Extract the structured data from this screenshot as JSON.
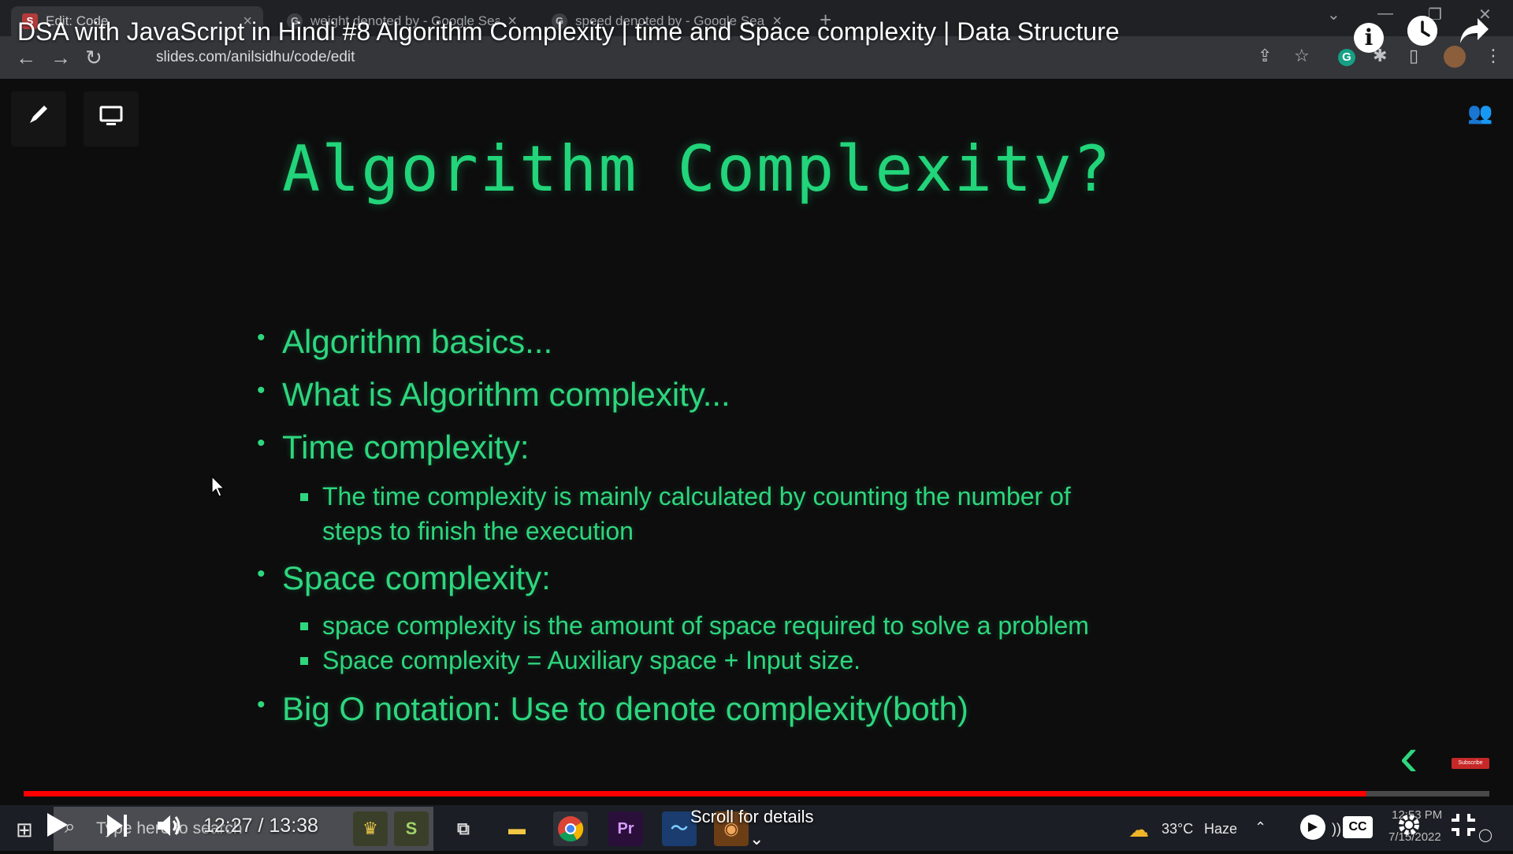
{
  "browser": {
    "tabs": [
      {
        "label": "Edit: Code",
        "favicon": "S"
      },
      {
        "label": "weight denoted by - Google Sear",
        "favicon": "G"
      },
      {
        "label": "speed denoted by - Google Sear",
        "favicon": "G"
      }
    ],
    "url": "slides.com/anilsidhu/code/edit"
  },
  "video": {
    "title": "DSA with JavaScript in Hindi #8 Algorithm Complexity | time and Space complexity | Data Structure",
    "current_time": "12:27",
    "duration": "13:38",
    "time_display": "12:27 / 13:38",
    "progress_fraction": 0.916,
    "scroll_hint": "Scroll for details"
  },
  "slide": {
    "title": "Algorithm Complexity?",
    "bullets": [
      {
        "level": 1,
        "text": "Algorithm basics..."
      },
      {
        "level": 1,
        "text": "What is Algorithm complexity..."
      },
      {
        "level": 1,
        "text": "Time complexity:"
      },
      {
        "level": 2,
        "text": "The time complexity is mainly calculated by counting the number of"
      },
      {
        "level": 2,
        "cont": true,
        "text": "steps to finish the execution"
      },
      {
        "level": 1,
        "text": "Space complexity:"
      },
      {
        "level": 2,
        "text": "space complexity is the amount of space required to solve a problem"
      },
      {
        "level": 2,
        "text": "Space complexity = Auxiliary space + Input size."
      },
      {
        "level": 1,
        "text": "Big O notation: Use to denote complexity(both)"
      }
    ],
    "accent": "#2ed67e",
    "subscribe_badge": "Subscribe"
  },
  "taskbar": {
    "search_placeholder": "Type here to search",
    "weather_temp": "33°C",
    "weather_desc": "Haze",
    "time": "12:53 PM",
    "date": "7/15/2022"
  },
  "icons": {
    "back": "←",
    "forward": "→",
    "reload": "↻",
    "lock": "🔒",
    "share": "⇪",
    "star": "☆",
    "puzzle": "✱",
    "menu": "⋮"
  },
  "colors": {
    "progress": "#ff0000",
    "slide_text": "#2ed67e"
  }
}
